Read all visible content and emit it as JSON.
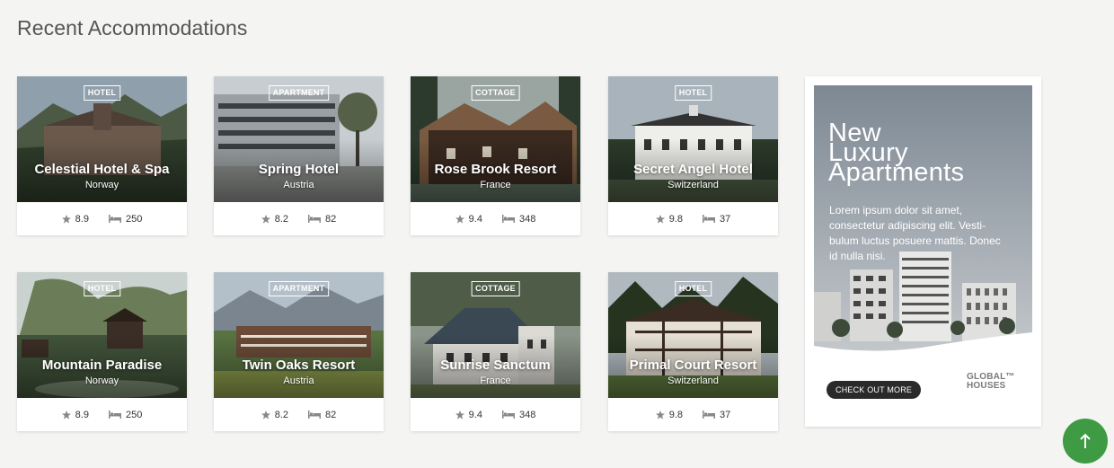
{
  "section": {
    "title": "Recent Accommodations"
  },
  "cards": [
    {
      "type": "Hotel",
      "name": "Celestial Hotel & Spa",
      "country": "Norway",
      "rating": "8.9",
      "rooms": "250",
      "scene": "castle"
    },
    {
      "type": "Apartment",
      "name": "Spring Hotel",
      "country": "Austria",
      "rating": "8.2",
      "rooms": "82",
      "scene": "modern"
    },
    {
      "type": "Cottage",
      "name": "Rose Brook Resort",
      "country": "France",
      "rating": "9.4",
      "rooms": "348",
      "scene": "cottage"
    },
    {
      "type": "Hotel",
      "name": "Secret Angel Hotel",
      "country": "Switzerland",
      "rating": "9.8",
      "rooms": "37",
      "scene": "manor"
    },
    {
      "type": "Hotel",
      "name": "Mountain Paradise",
      "country": "Norway",
      "rating": "8.9",
      "rooms": "250",
      "scene": "treehouse"
    },
    {
      "type": "Apartment",
      "name": "Twin Oaks Resort",
      "country": "Austria",
      "rating": "8.2",
      "rooms": "82",
      "scene": "lodge"
    },
    {
      "type": "Cottage",
      "name": "Sunrise Sanctum",
      "country": "France",
      "rating": "9.4",
      "rooms": "348",
      "scene": "alpine"
    },
    {
      "type": "Hotel",
      "name": "Primal Court Resort",
      "country": "Switzerland",
      "rating": "9.8",
      "rooms": "37",
      "scene": "timber"
    }
  ],
  "ad": {
    "headline_1": "New",
    "headline_2": "Luxury",
    "headline_3": "Apartments",
    "body": "Lorem ipsum dolor sit amet, consectetur adipiscing elit. Vesti-bulum luctus posuere mattis. Donec id nulla nisi.",
    "cta": "CHECK OUT MORE",
    "logo_1": "GLOBAL™",
    "logo_2": "HOUSES"
  },
  "icons": {
    "rating": "star-icon",
    "rooms": "bed-icon",
    "scroll": "arrow-up-icon"
  },
  "colors": {
    "accent_green": "#3f9a44",
    "cta_dark": "#2a2a2a"
  }
}
